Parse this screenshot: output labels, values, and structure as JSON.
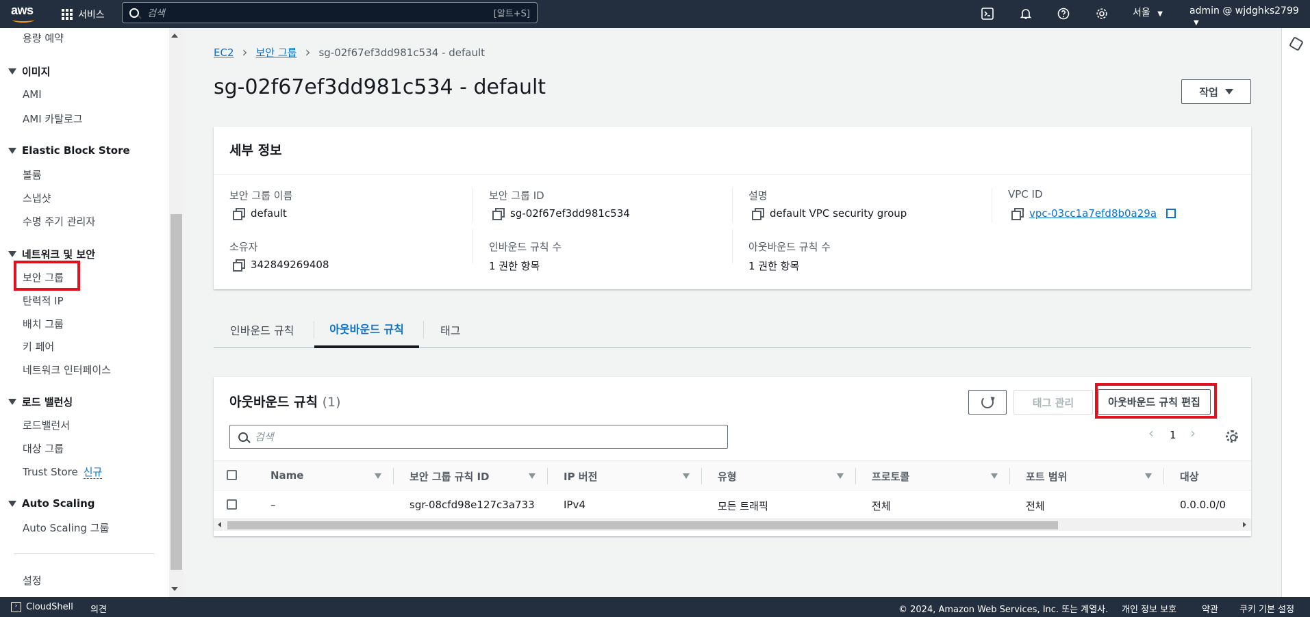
{
  "topnav": {
    "logo_text": "aws",
    "services_label": "서비스",
    "search_placeholder": "검색",
    "search_shortcut": "[알트+S]",
    "region": "서울",
    "account": "admin @ wjdghks2799"
  },
  "sidebar": {
    "top_item": "용량 예약",
    "sections": [
      {
        "title": "이미지",
        "items": [
          "AMI",
          "AMI 카탈로그"
        ]
      },
      {
        "title": "Elastic Block Store",
        "items": [
          "볼륨",
          "스냅샷",
          "수명 주기 관리자"
        ]
      },
      {
        "title": "네트워크 및 보안",
        "items": [
          "보안 그룹",
          "탄력적 IP",
          "배치 그룹",
          "키 페어",
          "네트워크 인터페이스"
        ]
      },
      {
        "title": "로드 밸런싱",
        "items": [
          "로드밸런서",
          "대상 그룹",
          "Trust Store"
        ]
      },
      {
        "title": "Auto Scaling",
        "items": [
          "Auto Scaling 그룹"
        ]
      }
    ],
    "new_badge": "신규",
    "settings": "설정"
  },
  "breadcrumb": {
    "ec2": "EC2",
    "sg": "보안 그룹",
    "current": "sg-02f67ef3dd981c534 - default"
  },
  "page": {
    "title": "sg-02f67ef3dd981c534 - default",
    "actions_label": "작업"
  },
  "details": {
    "header": "세부 정보",
    "fields": [
      {
        "label": "보안 그룹 이름",
        "value": "default"
      },
      {
        "label": "보안 그룹 ID",
        "value": "sg-02f67ef3dd981c534"
      },
      {
        "label": "설명",
        "value": "default VPC security group"
      },
      {
        "label": "VPC ID",
        "value": "vpc-03cc1a7efd8b0a29a"
      },
      {
        "label": "소유자",
        "value": "342849269408"
      },
      {
        "label": "인바운드 규칙 수",
        "value": "1 권한 항목"
      },
      {
        "label": "아웃바운드 규칙 수",
        "value": "1 권한 항목"
      }
    ]
  },
  "tabs": [
    "인바운드 규칙",
    "아웃바운드 규칙",
    "태그"
  ],
  "rules": {
    "title": "아웃바운드 규칙",
    "count": "(1)",
    "tag_button": "태그 관리",
    "edit_button": "아웃바운드 규칙 편집",
    "search_placeholder": "검색",
    "page": "1",
    "columns": [
      "Name",
      "보안 그룹 규칙 ID",
      "IP 버전",
      "유형",
      "프로토콜",
      "포트 범위",
      "대상"
    ],
    "rows": [
      {
        "name": "–",
        "rule_id": "sgr-08cfd98e127c3a733",
        "ip_version": "IPv4",
        "type": "모든 트래픽",
        "protocol": "전체",
        "port_range": "전체",
        "destination": "0.0.0.0/0"
      }
    ]
  },
  "footer": {
    "cloudshell": "CloudShell",
    "feedback": "의견",
    "copyright": "© 2024, Amazon Web Services, Inc. 또는 계열사.",
    "privacy": "개인 정보 보호",
    "terms": "약관",
    "cookies": "쿠키 기본 설정"
  },
  "colors": {
    "nav_bg": "#232f3e",
    "link": "#0972d3",
    "highlight": "#e0121f",
    "accent": "#ff9900"
  }
}
